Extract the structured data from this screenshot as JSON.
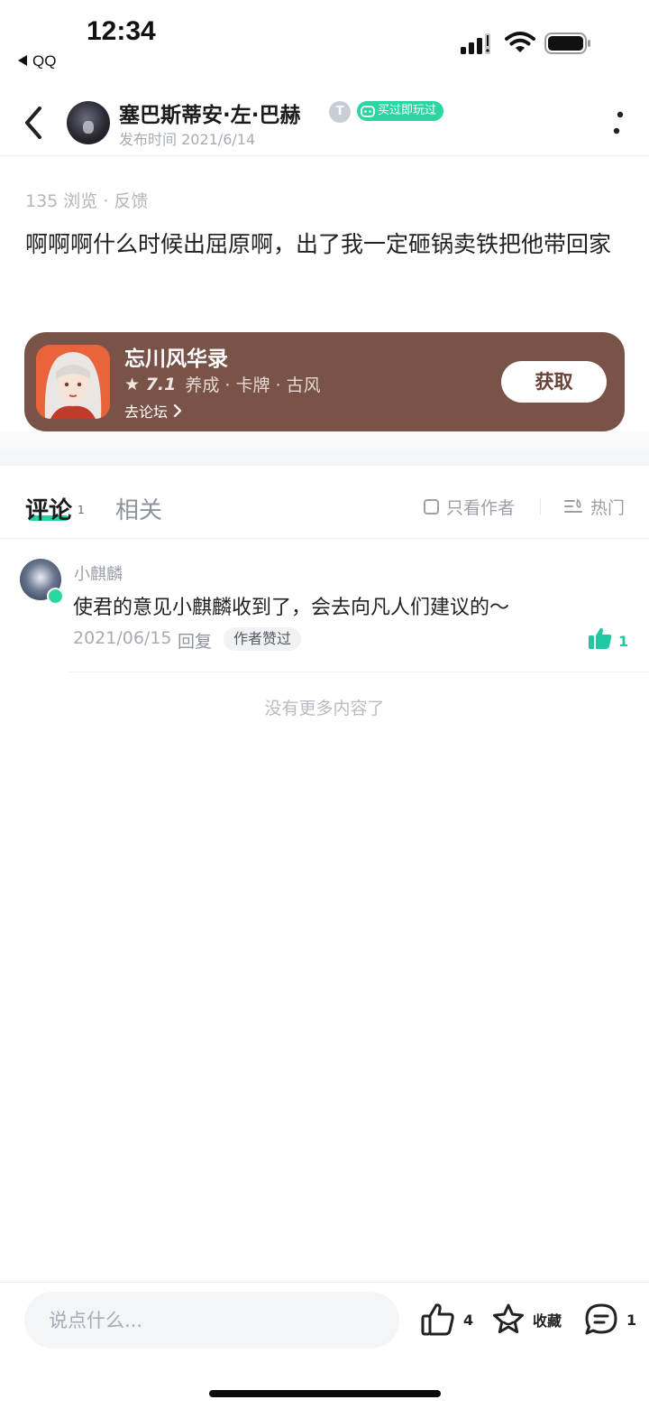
{
  "status_bar": {
    "time": "12:34",
    "back_app": "QQ"
  },
  "header": {
    "author_name": "塞巴斯蒂安·左·巴赫",
    "level_badge": "T",
    "played_badge": "买过即玩过",
    "publish_time": "发布时间 2021/6/14"
  },
  "post": {
    "stats": "135 浏览 · 反馈",
    "body": "啊啊啊什么时候出屈原啊，出了我一定砸锅卖铁把他带回家"
  },
  "game_card": {
    "name": "忘川风华录",
    "rating": "7.1",
    "tags": "养成 · 卡牌 · 古风",
    "forum_link": "去论坛",
    "get_button": "获取",
    "color_bg": "#7a5348"
  },
  "tabs": {
    "comments_label": "评论",
    "comments_count": "1",
    "related_label": "相关",
    "author_only_label": "只看作者",
    "sort_label": "热门"
  },
  "comments": [
    {
      "name": "小麒麟",
      "text": "使君的意见小麒麟收到了，会去向凡人们建议的～",
      "date": "2021/06/15",
      "reply_label": "回复",
      "liked_badge": "作者赞过",
      "like_count": "1"
    }
  ],
  "no_more": "没有更多内容了",
  "bottom_bar": {
    "input_placeholder": "说点什么...",
    "like_count": "4",
    "favorite_label": "收藏",
    "comment_count": "1"
  },
  "colors": {
    "accent": "#1fd4a4",
    "game_card": "#7a5348"
  }
}
